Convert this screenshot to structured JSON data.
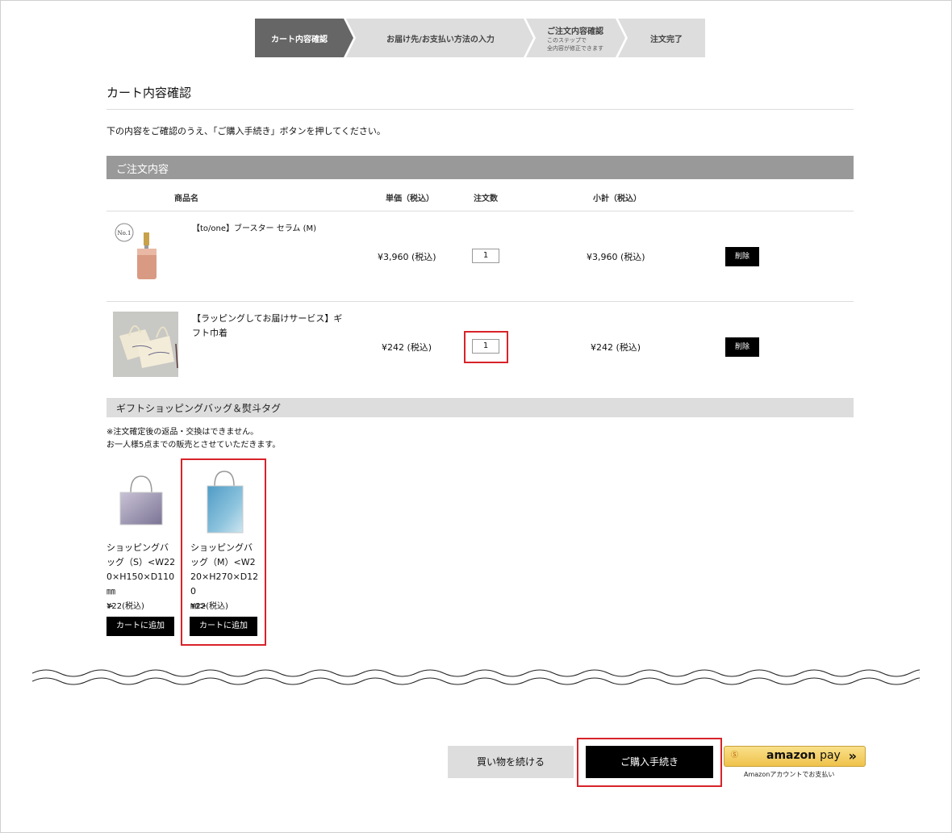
{
  "steps": [
    {
      "label": "カート内容確認",
      "sub": ""
    },
    {
      "label": "お届け先/お支払い方法の入力",
      "sub": ""
    },
    {
      "label": "ご注文内容確認",
      "sub1": "このステップで",
      "sub2": "全内容が修正できます"
    },
    {
      "label": "注文完了",
      "sub": ""
    }
  ],
  "page_title": "カート内容確認",
  "intro": "下の内容をご確認のうえ、「ご購入手続き」ボタンを押してください。",
  "order_section_title": "ご注文内容",
  "table_headers": {
    "product": "商品名",
    "unit_price": "単価（税込）",
    "quantity": "注文数",
    "subtotal": "小計（税込）"
  },
  "cart_items": [
    {
      "name": "【to/one】ブースター セラム (M)",
      "unit_price": "¥3,960 (税込)",
      "quantity": "1",
      "subtotal": "¥3,960 (税込)",
      "delete_label": "削除",
      "badge": "No.1",
      "image_icon": "serum-bottle-image"
    },
    {
      "name_line1": "【ラッピングしてお届けサービス】ギ",
      "name_line2": "フト巾着",
      "unit_price": "¥242 (税込)",
      "quantity": "1",
      "subtotal": "¥242 (税込)",
      "delete_label": "削除",
      "image_icon": "gift-pouch-image"
    }
  ],
  "gift_section_title": "ギフトショッピングバッグ＆熨斗タグ",
  "gift_notes": [
    "※注文確定後の返品・交換はできません。",
    "お一人様5点までの販売とさせていただきます。"
  ],
  "gift_bags": [
    {
      "name_lines": [
        "ショッピングバ",
        "ッグ（S）<W22",
        "0×H150×D110㎜",
        ">"
      ],
      "price": "¥22(税込)",
      "add_label": "カートに追加",
      "image_icon": "shopping-bag-s-image"
    },
    {
      "name_lines": [
        "ショッピングバ",
        "ッグ（M）<W2",
        "20×H270×D120",
        "㎜>"
      ],
      "price": "¥22(税込)",
      "add_label": "カートに追加",
      "image_icon": "shopping-bag-m-image"
    }
  ],
  "actions": {
    "continue_label": "買い物を続ける",
    "checkout_label": "ご購入手続き",
    "amazon_pay_brand": "amazon",
    "amazon_pay_suffix": "pay",
    "amazon_pay_arrow": "»",
    "amazon_pay_sub": "Amazonアカウントでお支払い"
  },
  "colors": {
    "active_step": "#666666",
    "inactive_step": "#dddddd",
    "highlight_red": "#d8232a",
    "section_bar": "#999999"
  }
}
